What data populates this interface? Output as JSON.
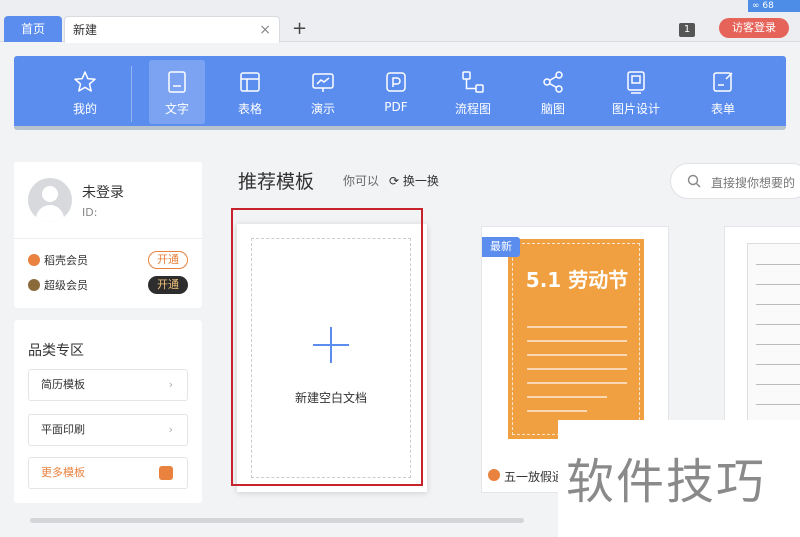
{
  "tabs": {
    "home": "首页",
    "current": "新建",
    "close": "×",
    "add": "+"
  },
  "window": {
    "count": "1",
    "login": "访客登录",
    "corner": "∞ 68"
  },
  "toolbar": {
    "items": [
      {
        "label": "我的",
        "icon": "star-icon"
      },
      {
        "label": "文字",
        "icon": "document-icon",
        "active": true
      },
      {
        "label": "表格",
        "icon": "table-icon"
      },
      {
        "label": "演示",
        "icon": "presentation-icon"
      },
      {
        "label": "PDF",
        "icon": "pdf-icon"
      },
      {
        "label": "流程图",
        "icon": "flowchart-icon"
      },
      {
        "label": "脑图",
        "icon": "mindmap-icon"
      },
      {
        "label": "图片设计",
        "icon": "image-design-icon"
      },
      {
        "label": "表单",
        "icon": "form-icon"
      }
    ]
  },
  "user": {
    "name": "未登录",
    "id": "ID:",
    "memberships": [
      {
        "name": "稻壳会员",
        "action": "开通",
        "color": "#e8823e"
      },
      {
        "name": "超级会员",
        "action": "开通",
        "color": "#2d2d2d"
      }
    ]
  },
  "categories": {
    "title": "品类专区",
    "items": [
      "简历模板",
      "平面印刷"
    ],
    "more": "更多模板"
  },
  "main": {
    "title": "推荐模板",
    "hint": "你可以",
    "swap": "换一换",
    "search_placeholder": "直接搜你想要的",
    "blank_label": "新建空白文档",
    "template1": {
      "badge": "最新",
      "poster_title": "5.1 劳动节",
      "name": "五一放假通"
    }
  },
  "watermark": "软件技巧",
  "colors": {
    "accent": "#5b8def",
    "selection": "#c8232c",
    "orange": "#e8823e"
  }
}
